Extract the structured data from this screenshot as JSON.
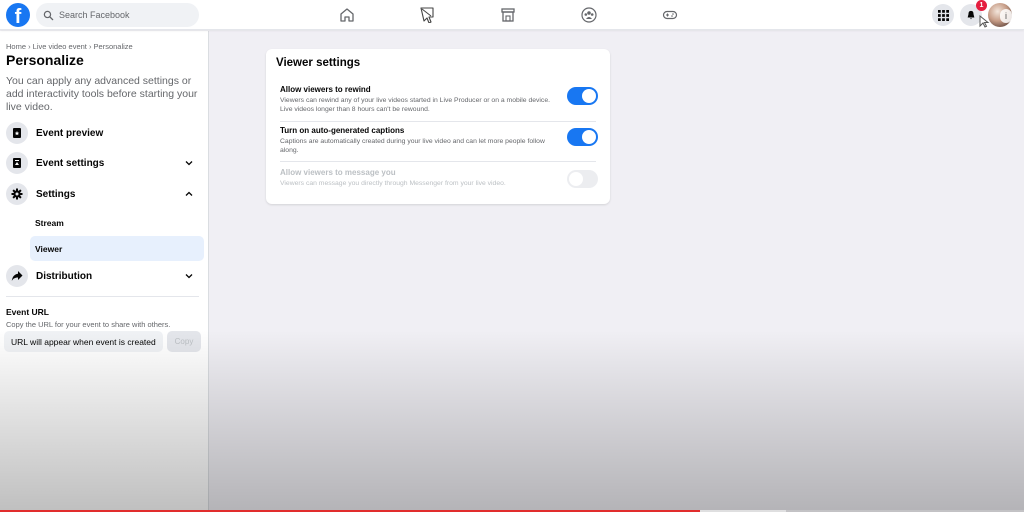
{
  "topbar": {
    "logo": "f",
    "search_placeholder": "Search Facebook",
    "nav_icons": [
      "home-icon",
      "watch-icon",
      "marketplace-icon",
      "groups-icon",
      "gaming-icon"
    ],
    "menu_icon": "grid-menu-icon",
    "notifications": {
      "icon": "bell-icon",
      "count": "1"
    },
    "avatar_info": "i"
  },
  "sidebar": {
    "breadcrumb": "Home › Live video event › Personalize",
    "title": "Personalize",
    "description": "You can apply any advanced settings or add interactivity tools before starting your live video.",
    "items": [
      {
        "label": "Event preview",
        "icon": "event-preview-icon",
        "chevron": ""
      },
      {
        "label": "Event settings",
        "icon": "event-settings-icon",
        "chevron": "down"
      },
      {
        "label": "Settings",
        "icon": "gear-icon",
        "chevron": "up"
      },
      {
        "label": "Distribution",
        "icon": "share-icon",
        "chevron": "down"
      }
    ],
    "sub_items": [
      {
        "label": "Stream",
        "active": false
      },
      {
        "label": "Viewer",
        "active": true
      }
    ],
    "event_url": {
      "title": "Event URL",
      "description": "Copy the URL for your event to share with others.",
      "input_value": "URL will appear when event is created",
      "copy_label": "Copy"
    }
  },
  "viewer_settings": {
    "title": "Viewer settings",
    "settings": [
      {
        "title": "Allow viewers to rewind",
        "description": "Viewers can rewind any of your live videos started in Live Producer or on a mobile device. Live videos longer than 8 hours can't be rewound.",
        "enabled": true,
        "disabled": false
      },
      {
        "title": "Turn on auto-generated captions",
        "description": "Captions are automatically created during your live video and can let more people follow along.",
        "enabled": true,
        "disabled": false
      },
      {
        "title": "Allow viewers to message you",
        "description": "Viewers can message you directly through Messenger from your live video.",
        "enabled": false,
        "disabled": true
      }
    ]
  },
  "video_progress": {
    "played_percent": 68.4,
    "buffered_percent": 76.8
  },
  "colors": {
    "accent": "#1877f2",
    "progress": "#e12d2d",
    "badge": "#e41e3f"
  }
}
